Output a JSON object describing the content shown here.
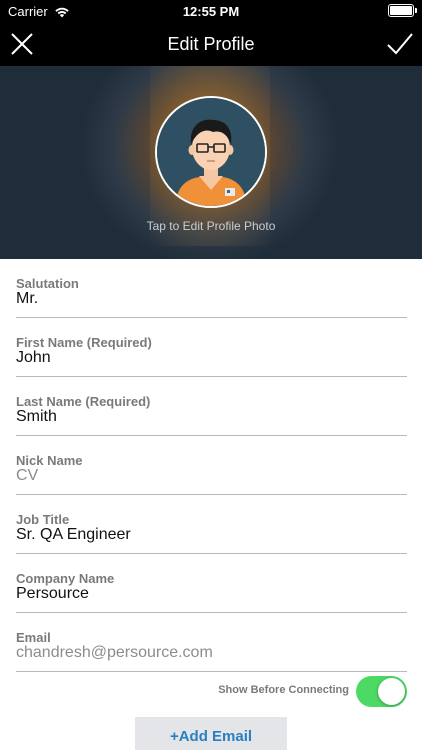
{
  "status_bar": {
    "carrier": "Carrier",
    "time": "12:55 PM"
  },
  "nav": {
    "title": "Edit Profile"
  },
  "header": {
    "photo_hint": "Tap to Edit Profile Photo"
  },
  "form": {
    "fields": [
      {
        "label": "Salutation",
        "value": "Mr."
      },
      {
        "label": "First Name (Required)",
        "value": "John"
      },
      {
        "label": "Last Name (Required)",
        "value": "Smith"
      },
      {
        "label": "Nick Name",
        "value": "CV"
      },
      {
        "label": "Job Title",
        "value": "Sr. QA Engineer"
      },
      {
        "label": "Company Name",
        "value": "Persource"
      },
      {
        "label": "Email",
        "value": "chandresh@persource.com"
      }
    ],
    "show_before_connecting": {
      "label": "Show Before Connecting",
      "on": true
    },
    "add_email_label": "+Add Email"
  },
  "colors": {
    "toggle_on": "#4cd964",
    "link_blue": "#2a7fc1"
  }
}
